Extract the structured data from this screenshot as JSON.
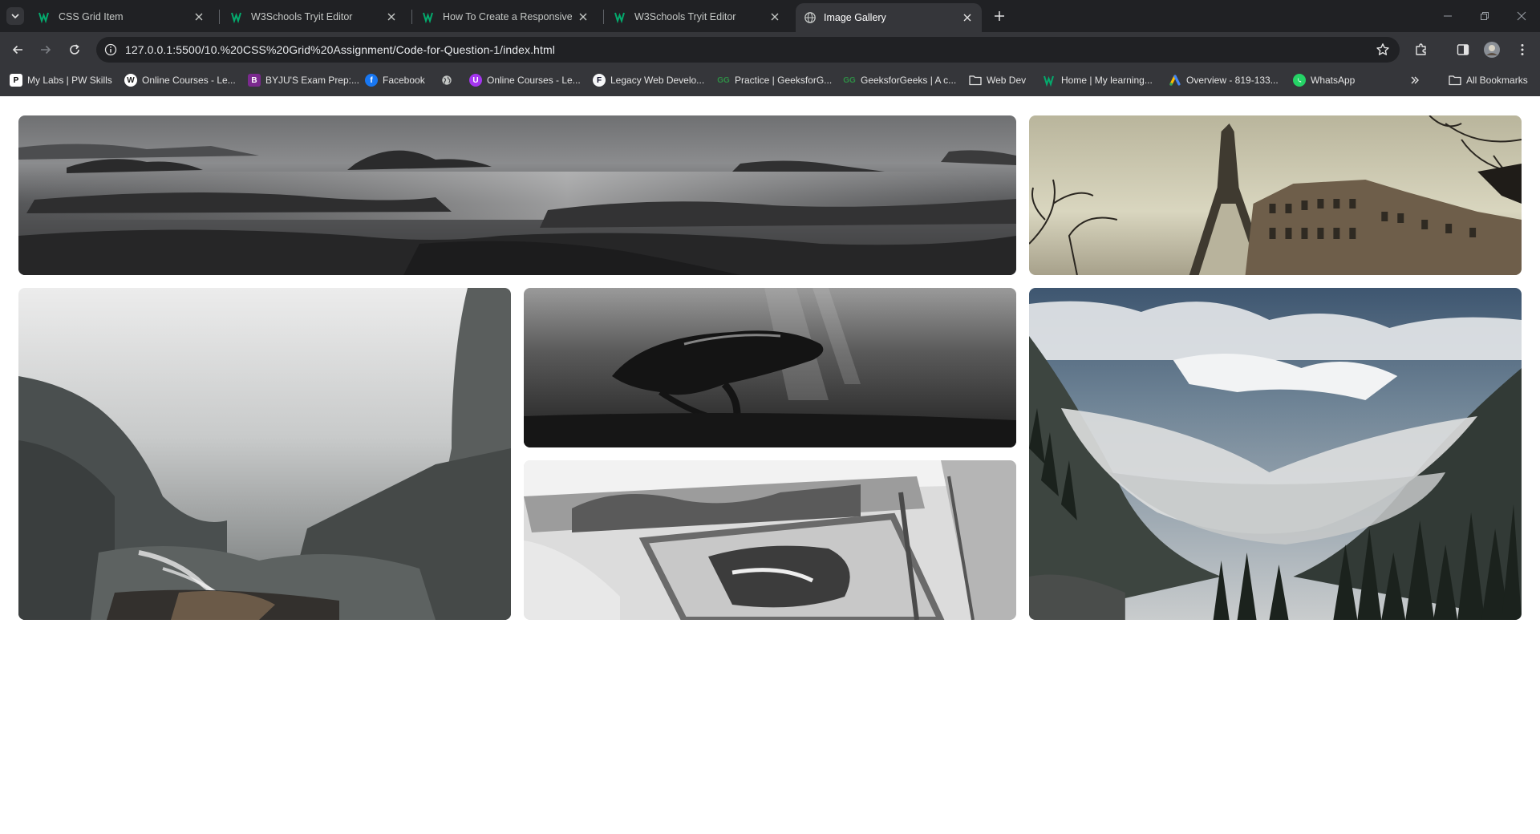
{
  "browser": {
    "tabs": [
      {
        "title": "CSS Grid Item",
        "favicon": "w3schools-icon",
        "active": false
      },
      {
        "title": "W3Schools Tryit Editor",
        "favicon": "w3schools-icon",
        "active": false
      },
      {
        "title": "How To Create a Responsive Im",
        "favicon": "w3schools-icon",
        "active": false
      },
      {
        "title": "W3Schools Tryit Editor",
        "favicon": "w3schools-icon",
        "active": false
      },
      {
        "title": "Image Gallery",
        "favicon": "globe-icon",
        "active": true
      }
    ],
    "url": "127.0.0.1:5500/10.%20CSS%20Grid%20Assignment/Code-for-Question-1/index.html",
    "bookmarks": [
      {
        "label": "My Labs | PW Skills",
        "icon": "pw-icon"
      },
      {
        "label": "Online Courses - Le...",
        "icon": "wordpress-icon"
      },
      {
        "label": "BYJU'S Exam Prep:...",
        "icon": "byjus-icon"
      },
      {
        "label": "Facebook",
        "icon": "facebook-icon"
      },
      {
        "label": "",
        "icon": "globe-icon"
      },
      {
        "label": "Online Courses - Le...",
        "icon": "udemy-icon"
      },
      {
        "label": "Legacy Web Develo...",
        "icon": "freecodecamp-icon"
      },
      {
        "label": "Practice | GeeksforG...",
        "icon": "gfg-icon"
      },
      {
        "label": "GeeksforGeeks | A c...",
        "icon": "gfg-icon"
      },
      {
        "label": "Web Dev",
        "icon": "folder-icon"
      },
      {
        "label": "Home | My learning...",
        "icon": "w3schools-icon"
      },
      {
        "label": "Overview - 819-133...",
        "icon": "google-ads-icon"
      },
      {
        "label": "WhatsApp",
        "icon": "whatsapp-icon"
      }
    ],
    "all_bookmarks": "All Bookmarks"
  },
  "gallery": {
    "images": [
      {
        "subject": "rocky-seashore-photo"
      },
      {
        "subject": "eiffel-tower-street-photo"
      },
      {
        "subject": "misty-canyon-waterfall-photo"
      },
      {
        "subject": "underwater-swimmer-photo"
      },
      {
        "subject": "couple-in-car-window-photo"
      },
      {
        "subject": "foggy-mountain-forest-photo"
      }
    ]
  },
  "colors": {
    "tabstrip": "#202124",
    "toolbar": "#35363a",
    "w3_green": "#04aa6d"
  }
}
